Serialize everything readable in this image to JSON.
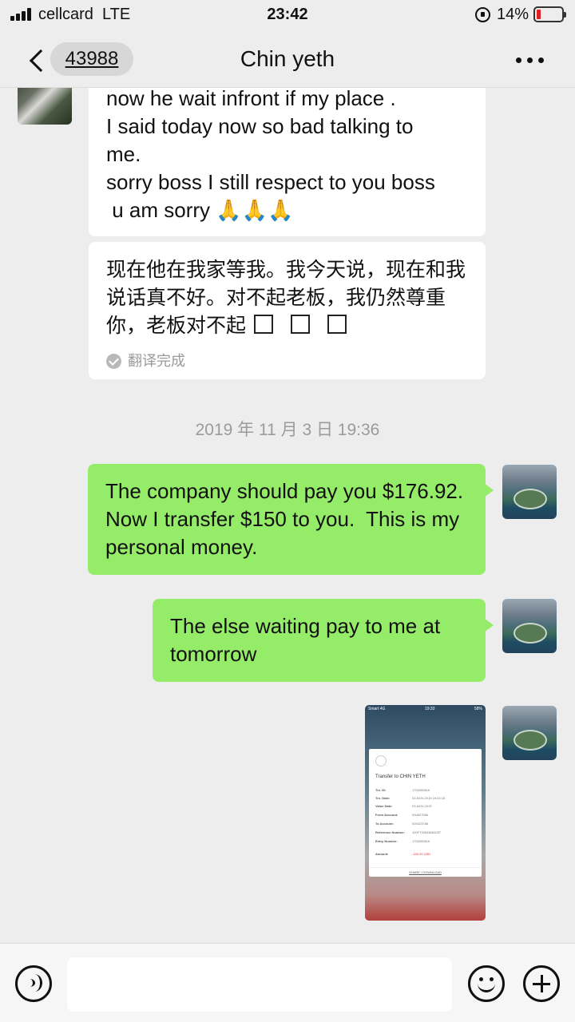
{
  "status_bar": {
    "carrier": "cellcard",
    "network": "LTE",
    "time": "23:42",
    "battery_percent": "14%",
    "icons": [
      "signal-icon",
      "rotation-lock-icon",
      "battery-icon"
    ]
  },
  "nav": {
    "unread_count": "43988",
    "title": "Chin yeth",
    "icons": [
      "back-icon",
      "more-icon"
    ]
  },
  "messages": {
    "incoming_1": {
      "lines": [
        "now he wait infront if my place .",
        "I said today now so bad talking to",
        "me.",
        "sorry boss I still respect to you boss",
        " u am sorry 🙏🙏🙏"
      ]
    },
    "translation": {
      "text": "现在他在我家等我。我今天说，现在和我说话真不好。对不起老板，我仍然尊重你，老板对不起",
      "status": "翻译完成"
    },
    "timestamp": "2019 年 11 月 3 日 19:36",
    "outgoing_1": {
      "text": "The company should pay you $176.92. Now I transfer $150 to you.  This is my personal money."
    },
    "outgoing_2": {
      "text": "The else waiting pay to me at tomorrow"
    },
    "outgoing_image": {
      "status_left": "Smart 4G",
      "status_time": "19:33",
      "status_right": "58%",
      "card_title": "Transfer to CHIN YETH",
      "rows": [
        {
          "label": "Trx. ID:",
          "value": "1754265816"
        },
        {
          "label": "Trx. Date:",
          "value": "03-NOV-2019 19:33:16"
        },
        {
          "label": "Value Date:",
          "value": "03-NOV-2019"
        },
        {
          "label": "From Account:",
          "value": "000827556"
        },
        {
          "label": "To Account:",
          "value": "000323788"
        },
        {
          "label": "Reference Number:",
          "value": "100FT30548083257"
        },
        {
          "label": "Entry Number:",
          "value": "1754265816"
        }
      ],
      "amount_label": "Amount:",
      "amount_value": "-150.00 USD",
      "share_label": "SHARE / DOWNLOAD",
      "colors": {
        "amount": "#dd3333"
      }
    }
  },
  "input_bar": {
    "icons": [
      "voice-icon",
      "emoji-icon",
      "plus-icon"
    ]
  },
  "colors": {
    "background": "#ededed",
    "outgoing_bubble": "#95ec69",
    "incoming_bubble": "#ffffff",
    "timestamp": "#9b9b9b"
  }
}
